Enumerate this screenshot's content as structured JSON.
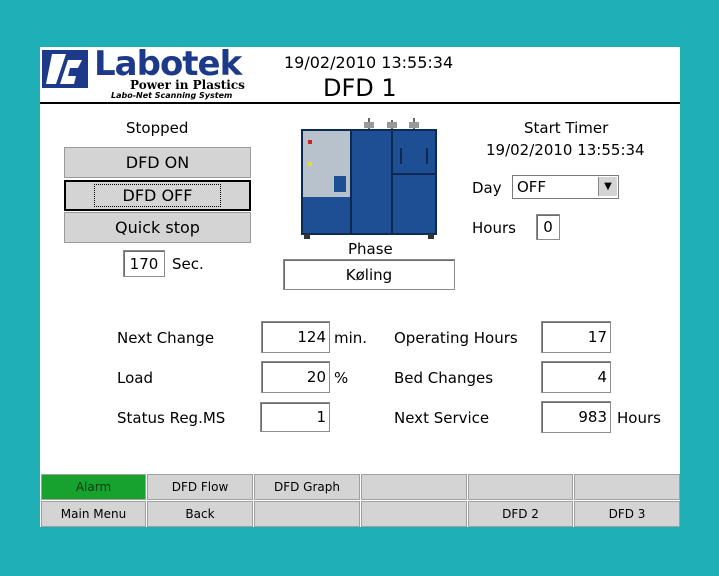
{
  "header": {
    "logo_text": "Labotek",
    "tagline": "Power in Plastics",
    "subtag": "Labo-Net Scanning System",
    "datetime": "19/02/2010 13:55:34",
    "title": "DFD 1"
  },
  "control": {
    "status": "Stopped",
    "on_label": "DFD ON",
    "off_label": "DFD OFF",
    "quick_stop_label": "Quick stop",
    "seconds_value": "170",
    "seconds_unit": "Sec."
  },
  "phase": {
    "label": "Phase",
    "value": "Køling"
  },
  "timer": {
    "label": "Start Timer",
    "datetime": "19/02/2010 13:55:34",
    "day_label": "Day",
    "day_value": "OFF",
    "hours_label": "Hours",
    "hours_value": "0"
  },
  "stats_left": [
    {
      "label": "Next Change",
      "value": "124",
      "unit": "min."
    },
    {
      "label": "Load",
      "value": "20",
      "unit": "%"
    },
    {
      "label": "Status Reg.MS",
      "value": "1",
      "unit": ""
    }
  ],
  "stats_right": [
    {
      "label": "Operating Hours",
      "value": "17",
      "unit": ""
    },
    {
      "label": "Bed Changes",
      "value": "4",
      "unit": ""
    },
    {
      "label": "Next Service",
      "value": "983",
      "unit": "Hours"
    }
  ],
  "nav_row1": [
    "Alarm",
    "DFD Flow",
    "DFD Graph",
    "",
    "",
    ""
  ],
  "nav_row2": [
    "Main Menu",
    "Back",
    "",
    "",
    "DFD 2",
    "DFD 3"
  ],
  "colors": {
    "background": "#1fafb6",
    "brand_blue": "#1d3a8a",
    "alarm_green": "#17a12f"
  }
}
